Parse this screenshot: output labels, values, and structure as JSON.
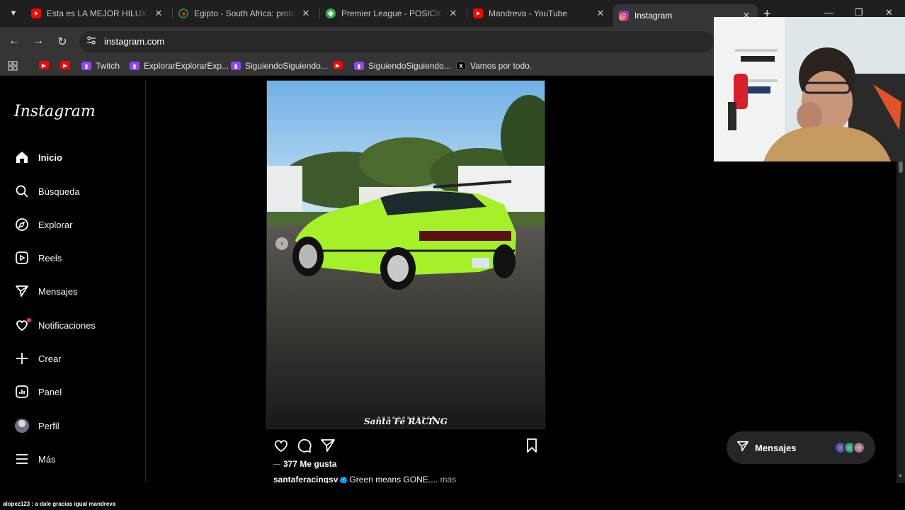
{
  "browser": {
    "tabs": [
      {
        "title": "Esta es LA MEJOR HILUX del",
        "favicon": "youtube-icon",
        "color": "#ff0000"
      },
      {
        "title": "Egipto - South Africa: probal",
        "favicon": "globe-icon",
        "color": "#1a8a3a"
      },
      {
        "title": "Premier League - POSICIONES",
        "favicon": "soccer-icon",
        "color": "#2fb34b"
      },
      {
        "title": "Mandreva - YouTube",
        "favicon": "youtube-icon",
        "color": "#ff0000"
      },
      {
        "title": "Instagram",
        "favicon": "instagram-icon",
        "color": "#e1306c",
        "active": true
      }
    ],
    "url": "instagram.com",
    "bookmarks": [
      {
        "label": "",
        "favicon": "youtube-icon"
      },
      {
        "label": "",
        "favicon": "youtube-icon"
      },
      {
        "label": "Twitch",
        "favicon": "twitch-icon"
      },
      {
        "label": "ExplorarExplorarExp...",
        "favicon": "twitch-icon"
      },
      {
        "label": "SiguiendoSiguiendo...",
        "favicon": "twitch-icon"
      },
      {
        "label": "",
        "favicon": "youtube-icon"
      },
      {
        "label": "SiguiendoSiguiendo...",
        "favicon": "twitch-icon"
      },
      {
        "label": "Vamos por todo.",
        "favicon": "x-icon"
      }
    ]
  },
  "instagram": {
    "logo": "Instagram",
    "nav": [
      {
        "label": "Inicio",
        "icon": "home-icon",
        "active": true
      },
      {
        "label": "Búsqueda",
        "icon": "search-icon"
      },
      {
        "label": "Explorar",
        "icon": "compass-icon"
      },
      {
        "label": "Reels",
        "icon": "reels-icon"
      },
      {
        "label": "Mensajes",
        "icon": "messenger-icon"
      },
      {
        "label": "Notificaciones",
        "icon": "heart-icon",
        "badge": true
      },
      {
        "label": "Crear",
        "icon": "plus-icon"
      },
      {
        "label": "Panel",
        "icon": "chart-icon"
      },
      {
        "label": "Perfil",
        "icon": "avatar"
      },
      {
        "label": "Más",
        "icon": "menu-icon"
      }
    ],
    "post": {
      "watermark": "Santa Fe RACING",
      "carousel_dots": 12,
      "active_dot": 12,
      "likes": "377 Me gusta",
      "username": "santaferacingsv",
      "caption": "Green means GONE....",
      "more": "más"
    },
    "messages_pill": {
      "label": "Mensajes"
    }
  },
  "chat": {
    "line": "alopez123 : a dale gracias igual mandreva"
  },
  "colors": {
    "accent_green_car": "#a6f02a",
    "verified_blue": "#0095f6",
    "notification_red": "#ff3040"
  }
}
